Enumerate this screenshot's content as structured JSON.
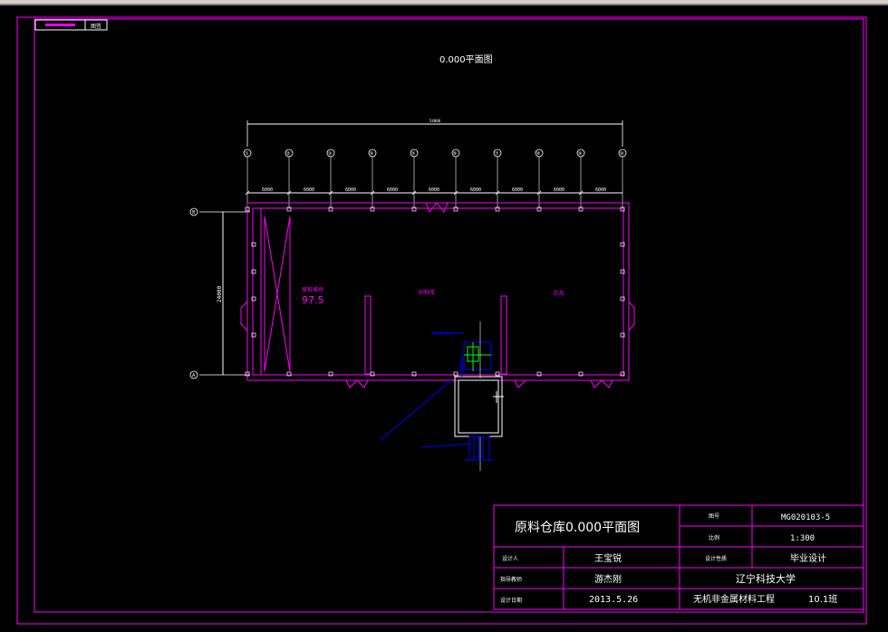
{
  "drawing": {
    "title": "0.000平面图",
    "small_tab": "图签",
    "colors": {
      "background": "#000000",
      "frame": "#ff00ff",
      "dimension": "#ffffff",
      "wall": "#ff00ff",
      "annotation": "#0000ff",
      "equipment": "#00ff00"
    }
  },
  "plan": {
    "axis_labels": [
      "①",
      "②",
      "③",
      "④",
      "⑤",
      "⑥",
      "⑦",
      "⑧",
      "⑨",
      "⑩"
    ],
    "row_labels": [
      "B",
      "A"
    ],
    "overall_dimension": "54000",
    "bay_dimensions": [
      "6000",
      "6000",
      "6000",
      "6000",
      "6000",
      "6000",
      "6000",
      "6000",
      "6000"
    ],
    "depth_dimension": "24000",
    "room_labels": [
      "原料堆场",
      "砂料库",
      "石灰"
    ],
    "elevation": "97.5",
    "pipe_label": "1700.00",
    "pipe_label2": "2400"
  },
  "title_block": {
    "drawing_name": "原料仓库0.000平面图",
    "drawing_no_label": "图号",
    "drawing_no": "MG020103-5",
    "scale_label": "比例",
    "scale": "1:300",
    "designer_label": "设计人",
    "designer": "王宝锐",
    "project_type_label": "设计性质",
    "project_type": "毕业设计",
    "advisor_label": "指导教师",
    "advisor": "游杰刚",
    "university": "辽宁科技大学",
    "date_label": "设计日期",
    "date": "2013.5.26",
    "major": "无机非金属材料工程",
    "class": "10.1班"
  }
}
